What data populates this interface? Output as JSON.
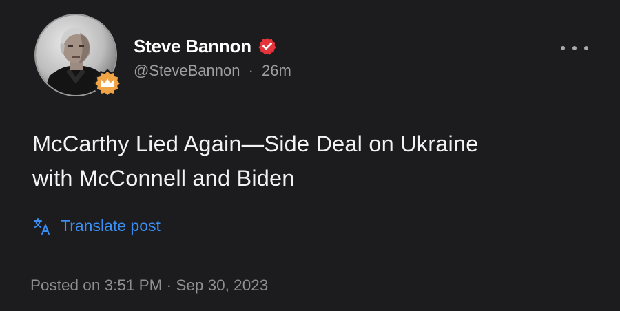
{
  "post": {
    "author": {
      "display_name": "Steve Bannon",
      "handle": "@SteveBannon",
      "separator": "·",
      "relative_time": "26m",
      "verified_icon": "verified-check-icon",
      "badge_icon": "crown-badge-icon"
    },
    "body_lines": [
      "McCarthy Lied Again—Side Deal on Ukraine",
      "with McConnell and Biden"
    ],
    "translate_label": "Translate post",
    "translate_icon": "translate-icon",
    "more_icon": "more-options-icon",
    "posted_on": "Posted on 3:51 PM · Sep 30, 2023"
  },
  "colors": {
    "background": "#1c1c1e",
    "link_blue": "#3a8ff5",
    "verified_red": "#e5343a",
    "badge_orange": "#f0a445",
    "secondary_text": "#9d9da2"
  }
}
